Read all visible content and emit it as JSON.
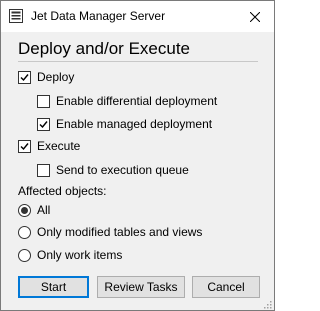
{
  "window": {
    "title": "Jet Data Manager Server",
    "accent_color": "#0078d7"
  },
  "dialog": {
    "heading": "Deploy and/or Execute",
    "options": {
      "deploy": {
        "label": "Deploy",
        "checked": true
      },
      "differential": {
        "label": "Enable differential deployment",
        "checked": false
      },
      "managed": {
        "label": "Enable managed deployment",
        "checked": true
      },
      "execute": {
        "label": "Execute",
        "checked": true
      },
      "queue": {
        "label": "Send to execution queue",
        "checked": false
      }
    },
    "affected": {
      "label": "Affected objects:",
      "choices": [
        {
          "label": "All",
          "selected": true
        },
        {
          "label": "Only modified tables and views",
          "selected": false
        },
        {
          "label": "Only work items",
          "selected": false
        }
      ]
    },
    "buttons": {
      "start": "Start",
      "review": "Review Tasks",
      "cancel": "Cancel"
    }
  }
}
